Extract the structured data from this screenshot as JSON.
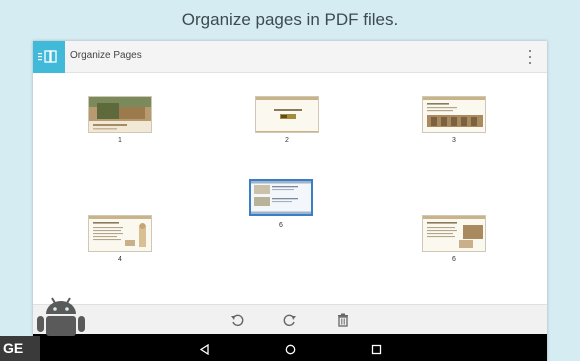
{
  "headline": "Organize pages in PDF files.",
  "appbar": {
    "title": "Organize Pages",
    "menu_icon": "overflow-menu-icon"
  },
  "pages": [
    {
      "label": "1",
      "kind": "photo"
    },
    {
      "label": "2",
      "kind": "title"
    },
    {
      "label": "3",
      "kind": "banner"
    },
    {
      "label": "4",
      "kind": "text"
    },
    {
      "label": "6",
      "kind": "selected"
    },
    {
      "label": "6",
      "kind": "text2"
    }
  ],
  "toolbar": {
    "rotate_left": "rotate-left-icon",
    "rotate_right": "rotate-right-icon",
    "delete": "trash-icon"
  },
  "navbar": {
    "back": "back-icon",
    "home": "home-icon",
    "recents": "recents-icon"
  },
  "watermark": {
    "text": "GE"
  },
  "colors": {
    "accent": "#41b9d9",
    "selection": "#3a7fc6",
    "background": "#d6ecf3"
  }
}
